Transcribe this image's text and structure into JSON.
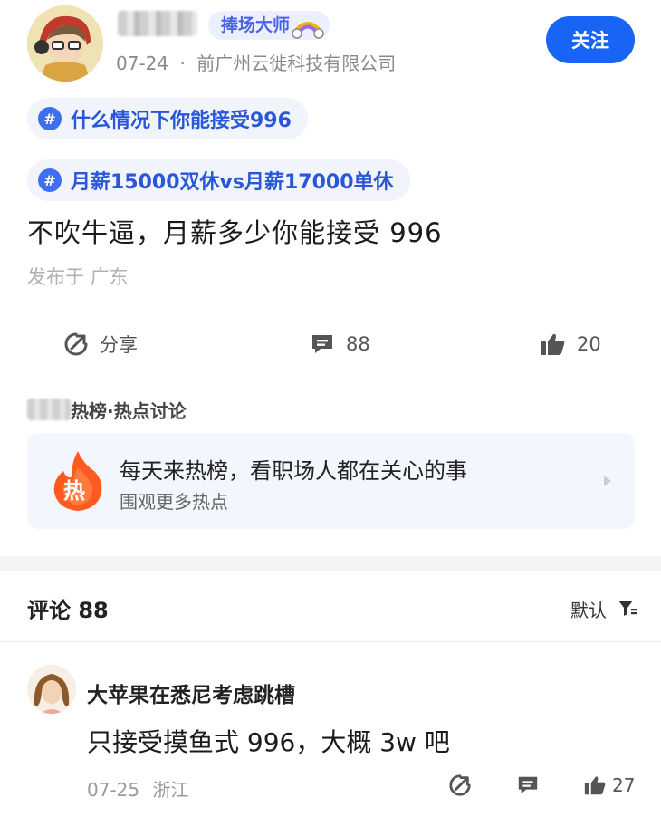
{
  "author": {
    "badge": "捧场大师",
    "date": "07-24",
    "separator": "·",
    "company": "前广州云徙科技有限公司",
    "follow_label": "关注"
  },
  "topics": [
    {
      "hash": "#",
      "label": "什么情况下你能接受996"
    },
    {
      "hash": "#",
      "label": "月薪15000双休vs月薪17000单休"
    }
  ],
  "post": {
    "text": "不吹牛逼，月薪多少你能接受 996",
    "location": "发布于 广东"
  },
  "actions": {
    "share_label": "分享",
    "comment_count": "88",
    "like_count": "20"
  },
  "hot": {
    "label": "热榜·热点讨论",
    "icon_char": "热",
    "title": "每天来热榜，看职场人都在关心的事",
    "subtitle": "围观更多热点"
  },
  "comments_header": {
    "title": "评论 88",
    "sort_label": "默认"
  },
  "comment": {
    "name": "大苹果在悉尼考虑跳槽",
    "text": "只接受摸鱼式 996，大概 3w 吧",
    "date": "07-25",
    "location": "浙江",
    "like_count": "27"
  },
  "colors": {
    "accent": "#1764f5",
    "topic_text": "#2957d8",
    "hot_orange": "#ff5a1f"
  },
  "icons": {
    "share": "share-icon",
    "comment": "comment-icon",
    "like": "thumbs-up-icon",
    "sort": "filter-icon",
    "hot": "flame-icon"
  }
}
